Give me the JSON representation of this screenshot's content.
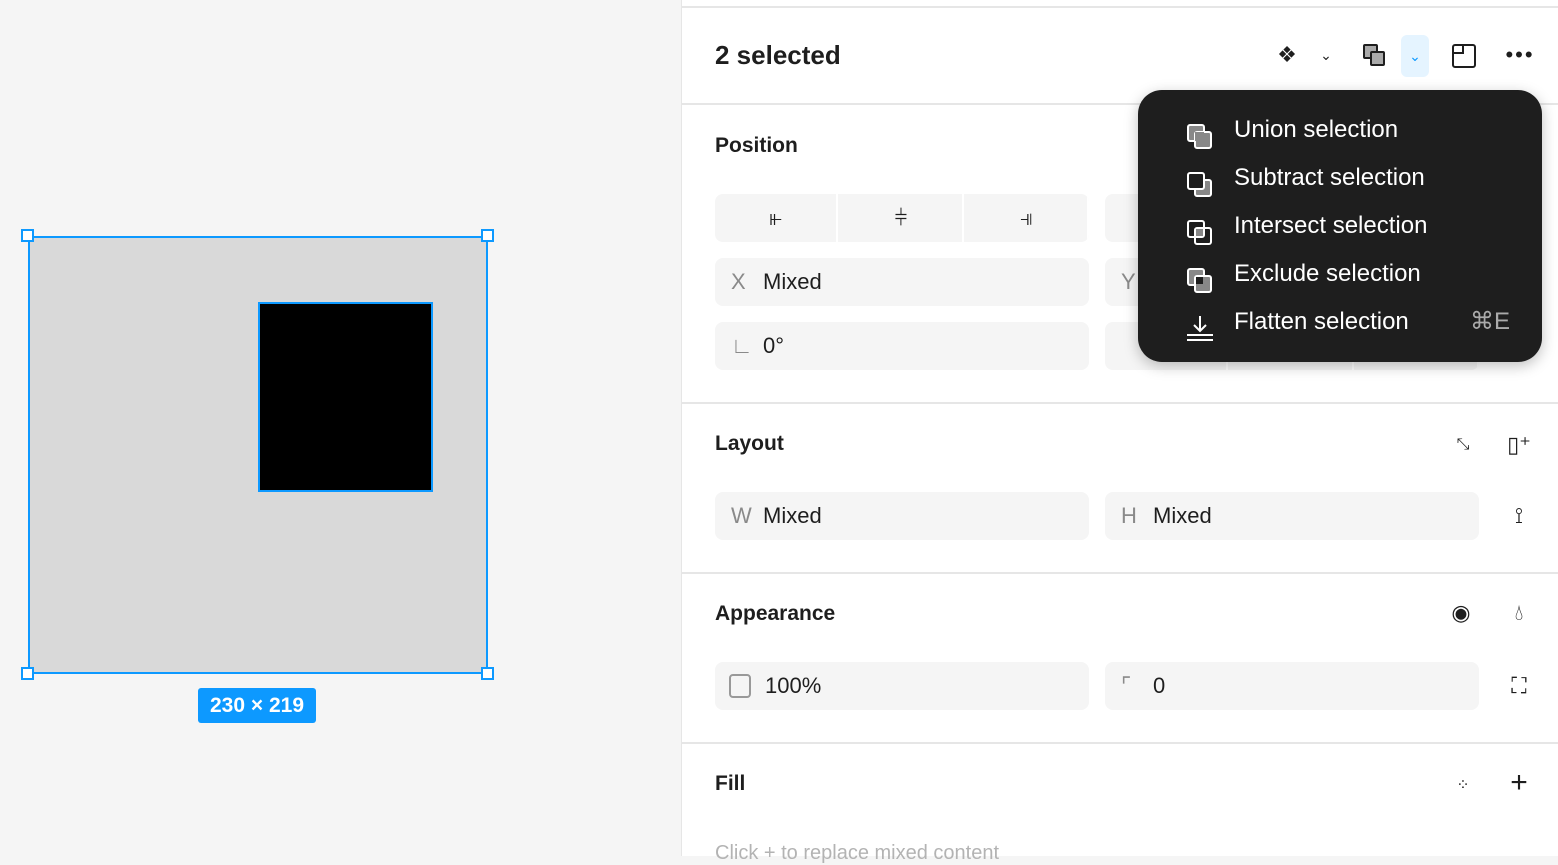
{
  "canvas": {
    "dimensions": "230 × 219",
    "selection_color": "#0d99ff"
  },
  "header": {
    "title": "2 selected",
    "icons": [
      "component-icon",
      "chevron-down-icon",
      "boolean-union-icon",
      "boolean-dropdown-icon",
      "frame-icon",
      "more-icon"
    ]
  },
  "position": {
    "title": "Position",
    "x_label": "X",
    "x_value": "Mixed",
    "y_label": "Y",
    "rotation_value": "0°"
  },
  "layout": {
    "title": "Layout",
    "w_label": "W",
    "w_value": "Mixed",
    "h_label": "H",
    "h_value": "Mixed"
  },
  "appearance": {
    "title": "Appearance",
    "opacity": "100%",
    "radius": "0"
  },
  "fill": {
    "title": "Fill",
    "hint": "Click + to replace mixed content"
  },
  "menu": {
    "items": [
      {
        "label": "Union selection",
        "shortcut": ""
      },
      {
        "label": "Subtract selection",
        "shortcut": ""
      },
      {
        "label": "Intersect selection",
        "shortcut": ""
      },
      {
        "label": "Exclude selection",
        "shortcut": ""
      },
      {
        "label": "Flatten selection",
        "shortcut": "⌘E"
      }
    ]
  }
}
